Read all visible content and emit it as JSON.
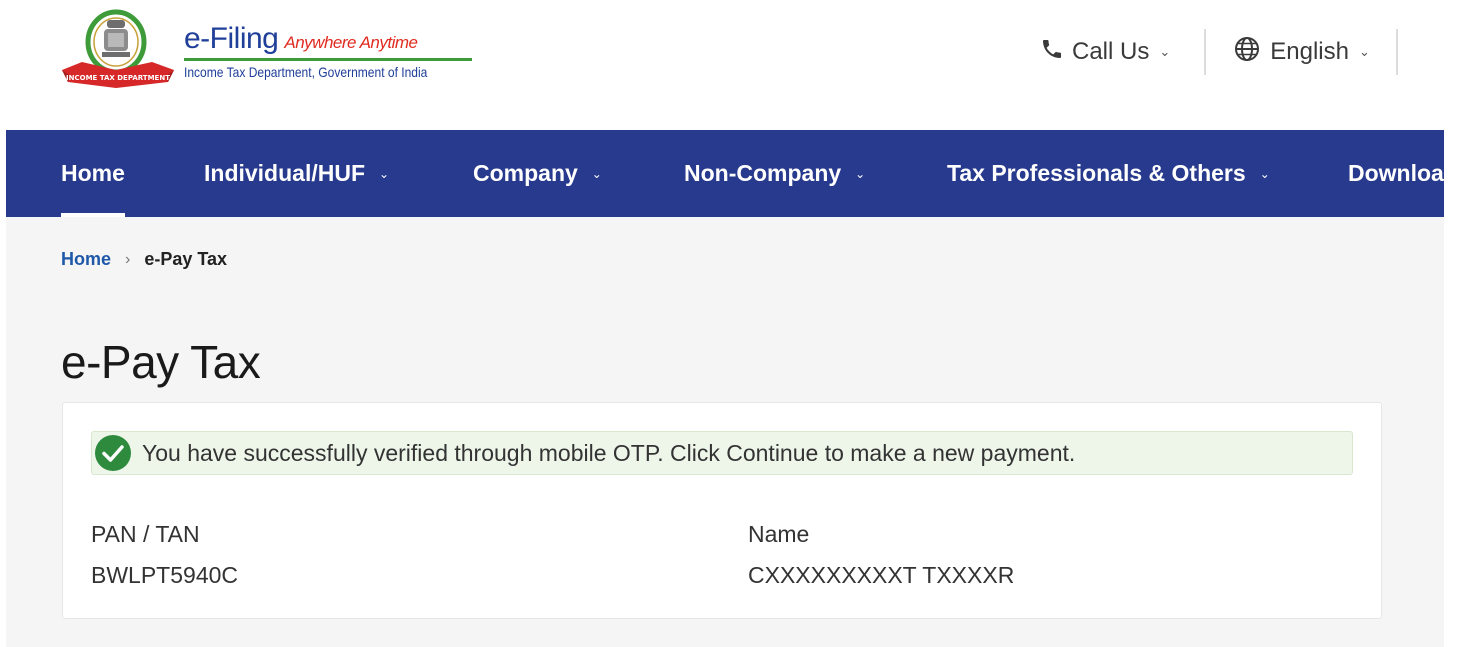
{
  "header": {
    "logo": {
      "emblem_icon": "india-emblem-icon",
      "brand_name": "e-Filing",
      "tagline": "Anywhere Anytime",
      "subtitle": "Income Tax Department, Government of India",
      "ribbon_text": "INCOME TAX DEPARTMENT"
    },
    "call_us": {
      "label": "Call Us",
      "icon": "phone-icon"
    },
    "language": {
      "label": "English",
      "icon": "globe-icon"
    }
  },
  "nav": {
    "items": [
      {
        "label": "Home",
        "active": true
      },
      {
        "label": "Individual/HUF",
        "dropdown": true
      },
      {
        "label": "Company",
        "dropdown": true
      },
      {
        "label": "Non-Company",
        "dropdown": true
      },
      {
        "label": "Tax Professionals & Others",
        "dropdown": true
      },
      {
        "label": "Downloa",
        "dropdown": false
      }
    ]
  },
  "breadcrumb": {
    "home": "Home",
    "separator": "›",
    "current": "e-Pay Tax"
  },
  "page": {
    "title": "e-Pay Tax",
    "alert": {
      "icon": "check-circle-icon",
      "message": "You have successfully verified through mobile OTP. Click Continue to make a new payment."
    },
    "fields": [
      {
        "label": "PAN / TAN",
        "value": "BWLPT5940C"
      },
      {
        "label": "Name",
        "value": "CXXXXXXXXXT TXXXXR"
      }
    ]
  },
  "colors": {
    "nav_bg": "#283a8d",
    "brand_blue": "#1f3f99",
    "brand_red": "#e02b20",
    "brand_green": "#3e9b39",
    "success_green": "#2e8b3e",
    "alert_bg": "#eef6ea",
    "page_bg": "#f5f5f5"
  }
}
